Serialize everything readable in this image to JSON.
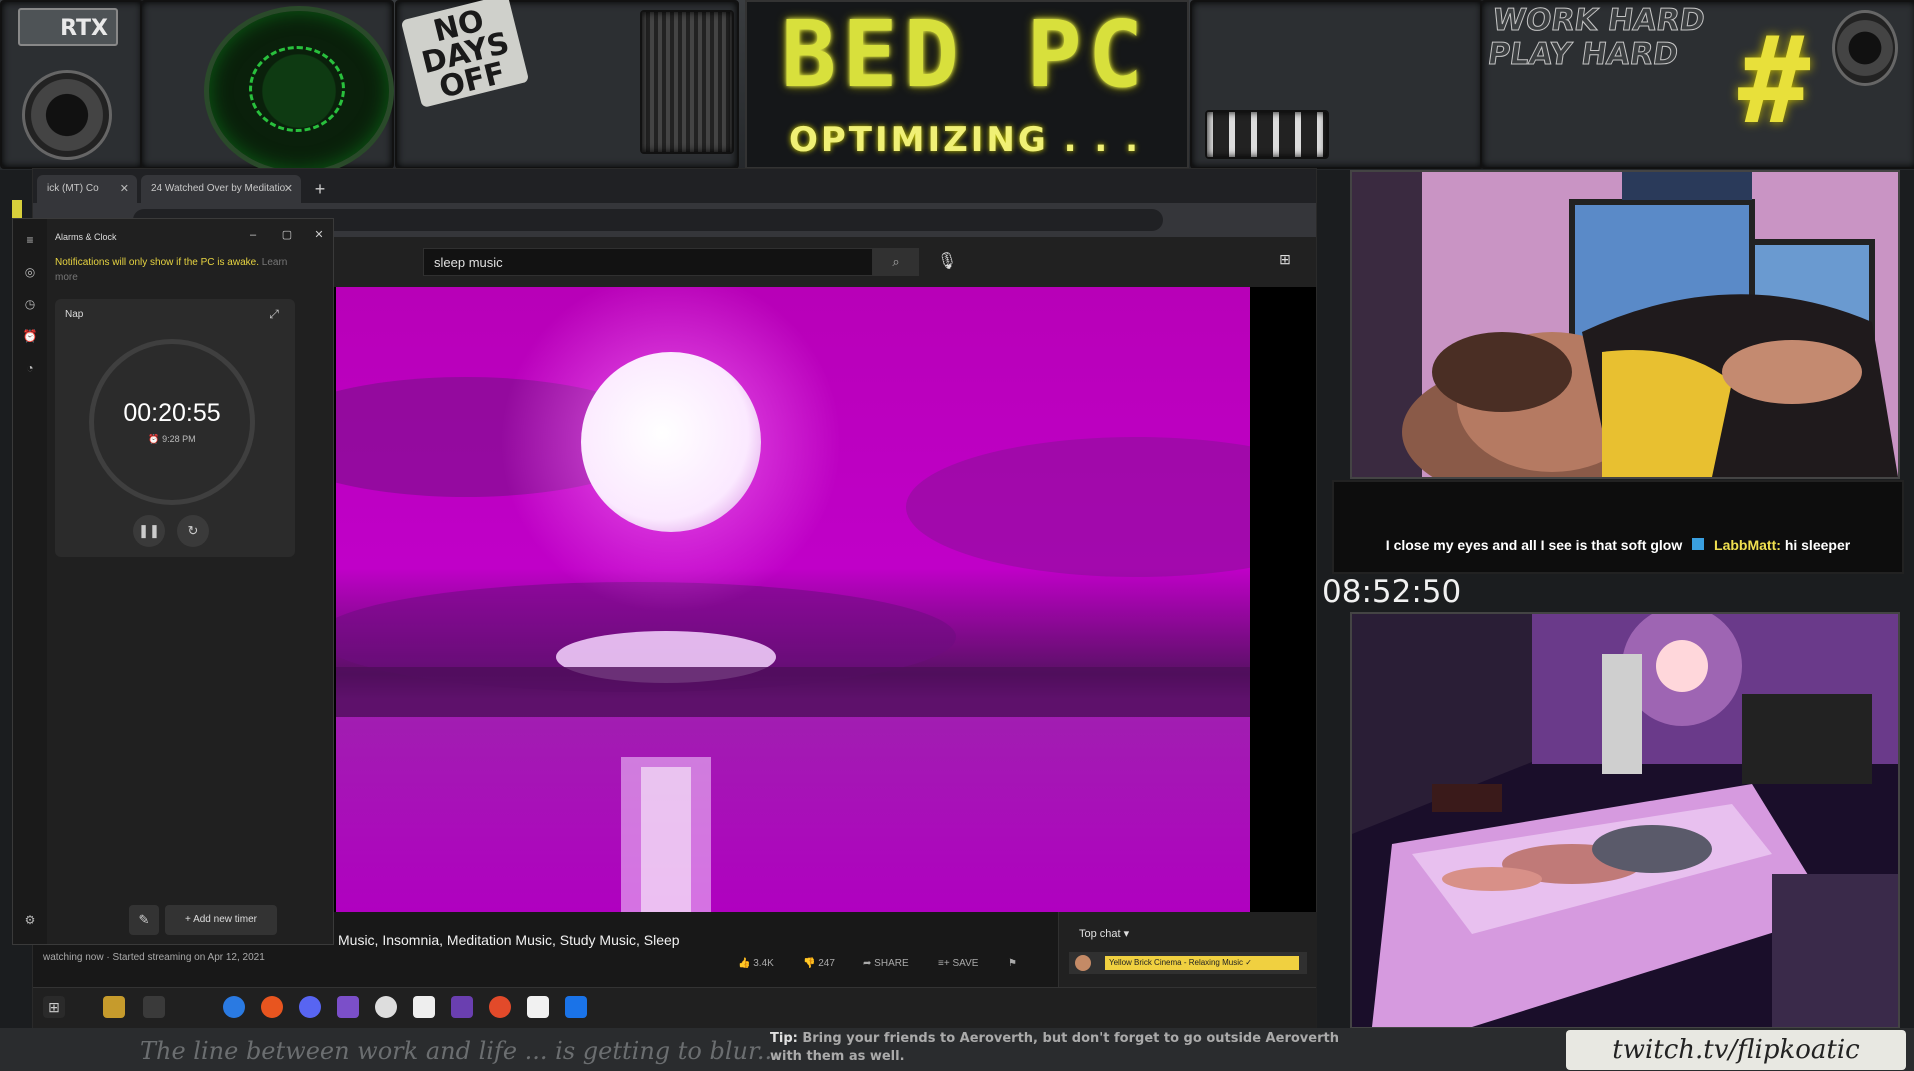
{
  "overlay": {
    "gpu_badge": "RTX",
    "sticker": "NO DAYS OFF",
    "title": "BED PC",
    "subtitle": "OPTIMIZING . . .",
    "slogan": "WORK HARD PLAY HARD",
    "hash_sign": "#",
    "accent_color": "#d8e03c"
  },
  "browser": {
    "tabs": [
      {
        "label": "ick (MT) Co"
      },
      {
        "label": "24 Watched Over by Meditatio"
      }
    ],
    "new_tab": "+",
    "close_glyph": "✕"
  },
  "youtube": {
    "search_value": "sleep music",
    "search_icon": "⌕",
    "mic_icon": "🎙",
    "create_icon": "⊞",
    "video_title": "Music, Insomnia, Meditation Music, Study Music, Sleep",
    "stream_meta": "watching now · Started streaming on Apr 12, 2021",
    "actions": {
      "likes": "3.4K",
      "dislikes": "247",
      "share": "SHARE",
      "save": "SAVE"
    },
    "chat": {
      "header": "Top chat ▾",
      "pinned": "Yellow Brick Cinema - Relaxing Music ✓"
    }
  },
  "clock_app": {
    "title": "Alarms & Clock",
    "notice": "Notifications will only show if the PC is awake.",
    "notice_link": "Learn more",
    "timer": {
      "name": "Nap",
      "value": "00:20:55",
      "ends_at": "⏰ 9:28 PM"
    },
    "add_timer": "Add new timer"
  },
  "stream": {
    "caption_text": "I close my eyes and all I see is that soft glow",
    "caption_user": "LabbMatt:",
    "caption_message": "hi sleeper",
    "clock": "08:52:50"
  },
  "footer": {
    "handwriting": "The line between work and life ... is getting to blur...",
    "tip_label": "Tip:",
    "tip_text": "Bring your friends to Aeroverth, but don't forget to go outside Aeroverth with them as well.",
    "twitch_handle": "twitch.tv/flipkoatic"
  }
}
